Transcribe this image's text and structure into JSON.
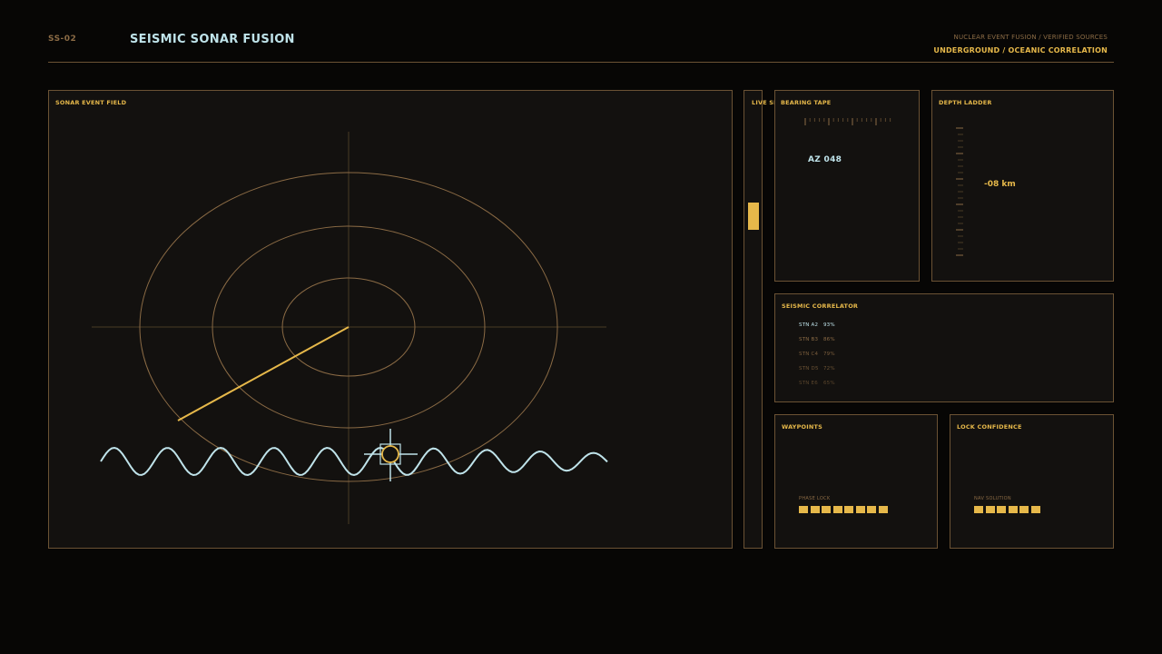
{
  "header": {
    "code": "SS-02",
    "title": "SEISMIC SONAR FUSION",
    "small_caption": "NUCLEAR EVENT FUSION / VERIFIED SOURCES",
    "subtitle": "UNDERGROUND / OCEANIC CORRELATION"
  },
  "sonar": {
    "title": "SONAR EVENT FIELD"
  },
  "seam": {
    "title": "LIVE SEAM"
  },
  "bearing": {
    "title": "BEARING TAPE",
    "readout": "AZ 048"
  },
  "depth": {
    "title": "DEPTH LADDER",
    "readout": "-08 km"
  },
  "correlator": {
    "title": "SEISMIC CORRELATOR",
    "stations": [
      {
        "station": "STN A2",
        "value": "93%"
      },
      {
        "station": "STN B3",
        "value": "86%"
      },
      {
        "station": "STN C4",
        "value": "79%"
      },
      {
        "station": "STN D5",
        "value": "72%"
      },
      {
        "station": "STN E6",
        "value": "65%"
      }
    ]
  },
  "waypoints": {
    "title": "WAYPOINTS",
    "bar_label": "PHASE LOCK",
    "filled_segments": 8
  },
  "lock": {
    "title": "LOCK CONFIDENCE",
    "bar_label": "NAV SOLUTION",
    "filled_segments": 6
  },
  "colors": {
    "accent": "#e6b84a",
    "frame": "#6b5234",
    "cyan": "#bfe3ea",
    "background": "#070605"
  }
}
